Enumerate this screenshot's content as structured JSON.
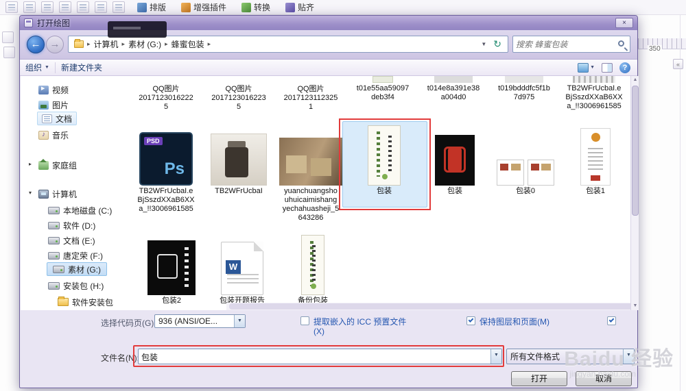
{
  "colors": {
    "title_purple": "#9d8fc9",
    "annotation_red": "#e23b3b",
    "link_blue": "#2456b0",
    "selection_blue": "#d9ebfa"
  },
  "app": {
    "toolbar_tabs": [
      {
        "label": "排版"
      },
      {
        "label": "增强插件"
      },
      {
        "label": "转换"
      },
      {
        "label": "贴齐"
      }
    ],
    "ruler_value": "350"
  },
  "dialog": {
    "title": "打开绘图",
    "close_label": "×",
    "breadcrumb": {
      "items": [
        "计算机",
        "素材 (G:)",
        "蜂蜜包装"
      ]
    },
    "search": {
      "placeholder": "搜索 蜂蜜包装"
    },
    "toolbar": {
      "organize": "组织",
      "new_folder": "新建文件夹"
    },
    "sidebar": {
      "items": [
        {
          "label": "视频",
          "icon": "video-library-icon"
        },
        {
          "label": "图片",
          "icon": "picture-library-icon"
        },
        {
          "label": "文档",
          "icon": "document-library-icon"
        },
        {
          "label": "音乐",
          "icon": "music-library-icon"
        },
        {
          "label": "家庭组",
          "icon": "homegroup-icon"
        },
        {
          "label": "计算机",
          "icon": "computer-icon"
        },
        {
          "label": "本地磁盘 (C:)",
          "icon": "drive-icon"
        },
        {
          "label": "软件 (D:)",
          "icon": "drive-icon"
        },
        {
          "label": "文档 (E:)",
          "icon": "drive-icon"
        },
        {
          "label": "唐定荣 (F:)",
          "icon": "drive-icon"
        },
        {
          "label": "素材 (G:)",
          "icon": "drive-icon"
        },
        {
          "label": "安装包 (H:)",
          "icon": "drive-icon"
        },
        {
          "label": "软件安装包",
          "icon": "folder-icon"
        }
      ]
    },
    "files": {
      "row1": [
        {
          "label": "QQ图片2017123016222\n5"
        },
        {
          "label": "QQ图片2017123016223\n5"
        },
        {
          "label": "QQ图片2017123112325\n1"
        },
        {
          "label": "t01e55aa59097\ndeb3f4"
        },
        {
          "label": "t014e8a391e38\na004d0"
        },
        {
          "label": "t019bdddfc5f1b\n7d975"
        },
        {
          "label": "TB2WFrUcbaI.e\nBjSszdXXaB6XX\na_!!3006961585"
        }
      ],
      "row2": [
        {
          "label": "TB2WFrUcbaI.e\nBjSszdXXaB6XX\na_!!3006961585",
          "thumb": "psd-file"
        },
        {
          "label": "TB2WFrUcbaI",
          "thumb": "jar-photo"
        },
        {
          "label": "yuanchuangsho\nuhuicaimishang\nyechahuasheji_5\n643286",
          "thumb": "tea-photo"
        },
        {
          "label": "包装",
          "thumb": "tall-package",
          "selected": true
        },
        {
          "label": "包装",
          "thumb": "black-red-seal"
        },
        {
          "label": "包装0",
          "thumb": "cards"
        },
        {
          "label": "包装1",
          "thumb": "tall-white-package"
        }
      ],
      "row3": [
        {
          "label": "包装2",
          "thumb": "black-white-seal"
        },
        {
          "label": "包装开题报告",
          "thumb": "word-document"
        },
        {
          "label": "备份包装",
          "thumb": "tall-package"
        }
      ]
    },
    "codepage": {
      "label": "选择代码页(G)",
      "value": "936  (ANSI/OE..."
    },
    "checkboxes": [
      {
        "label": "提取嵌入的 ICC 预置文件",
        "label2": "(X)",
        "checked": false
      },
      {
        "label": "保持图层和页面(M)",
        "checked": true
      },
      {
        "label": "",
        "checked": true
      }
    ],
    "filename": {
      "label": "文件名(N):",
      "value": "包装"
    },
    "filetype": {
      "value": "所有文件格式"
    },
    "buttons": {
      "open": "打开",
      "cancel": "取消"
    }
  },
  "watermark": {
    "line1": "Baidu 经验",
    "line2": "jingyan.baidu.com"
  }
}
